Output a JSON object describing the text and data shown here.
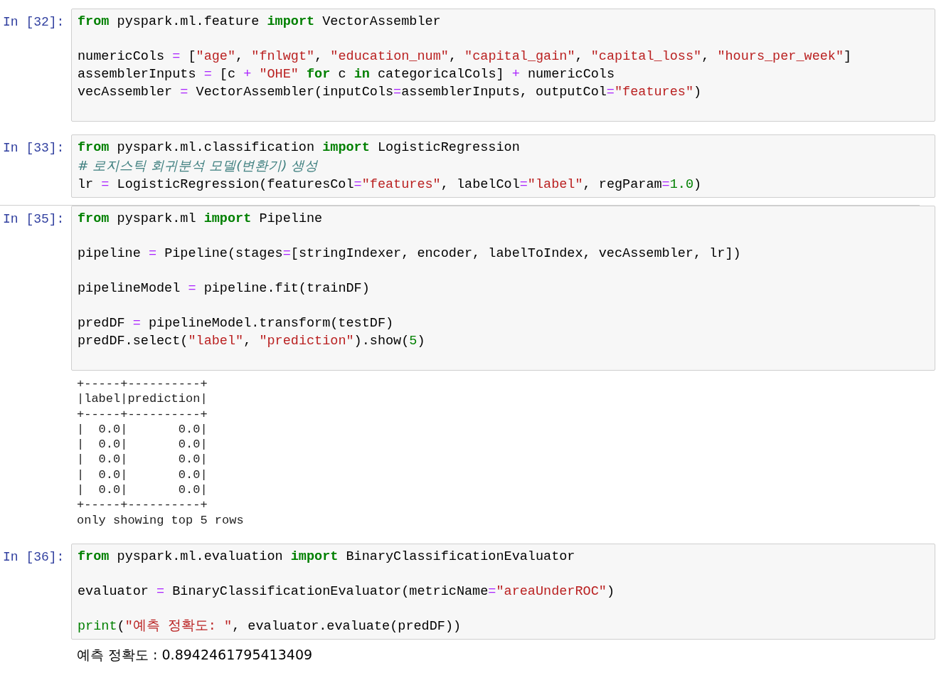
{
  "cells": [
    {
      "prompt": "In [32]:",
      "blocks": [
        [
          [
            {
              "kw": "from"
            },
            {
              "p": " pyspark.ml.feature "
            },
            {
              "kw": "import"
            },
            {
              "p": " VectorAssembler"
            }
          ]
        ],
        [
          [
            {
              "p": "numericCols "
            },
            {
              "op": "="
            },
            {
              "p": " ["
            },
            {
              "str": "\"age\""
            },
            {
              "p": ", "
            },
            {
              "str": "\"fnlwgt\""
            },
            {
              "p": ", "
            },
            {
              "str": "\"education_num\""
            },
            {
              "p": ", "
            },
            {
              "str": "\"capital_gain\""
            },
            {
              "p": ", "
            },
            {
              "str": "\"capital_loss\""
            },
            {
              "p": ", "
            },
            {
              "str": "\"hours_per_week\""
            },
            {
              "p": "]"
            }
          ],
          [
            {
              "p": "assemblerInputs "
            },
            {
              "op": "="
            },
            {
              "p": " [c "
            },
            {
              "op": "+"
            },
            {
              "str": " \"OHE\""
            },
            {
              "kw": " for"
            },
            {
              "p": " c "
            },
            {
              "kw": "in"
            },
            {
              "p": " categoricalCols] "
            },
            {
              "op": "+"
            },
            {
              "p": " numericCols"
            }
          ],
          [
            {
              "p": "vecAssembler "
            },
            {
              "op": "="
            },
            {
              "p": " VectorAssembler(inputCols"
            },
            {
              "op": "="
            },
            {
              "p": "assemblerInputs, outputCol"
            },
            {
              "op": "="
            },
            {
              "str": "\"features\""
            },
            {
              "p": ")"
            }
          ]
        ]
      ],
      "trailing_space": true
    },
    {
      "prompt": "In [33]:",
      "blocks": [
        [
          [
            {
              "kw": "from"
            },
            {
              "p": " pyspark.ml.classification "
            },
            {
              "kw": "import"
            },
            {
              "p": " LogisticRegression"
            }
          ],
          [
            {
              "com": "# 로지스틱 회귀분석 모델(변환기) 생성"
            }
          ],
          [
            {
              "p": "lr "
            },
            {
              "op": "="
            },
            {
              "p": " LogisticRegression(featuresCol"
            },
            {
              "op": "="
            },
            {
              "str": "\"features\""
            },
            {
              "p": ", labelCol"
            },
            {
              "op": "="
            },
            {
              "str": "\"label\""
            },
            {
              "p": ", regParam"
            },
            {
              "op": "="
            },
            {
              "num": "1.0"
            },
            {
              "p": ")"
            }
          ]
        ]
      ],
      "trailing_space": false
    },
    {
      "prompt": "In [35]:",
      "blocks": [
        [
          [
            {
              "kw": "from"
            },
            {
              "p": " pyspark.ml "
            },
            {
              "kw": "import"
            },
            {
              "p": " Pipeline"
            }
          ]
        ],
        [
          [
            {
              "p": "pipeline "
            },
            {
              "op": "="
            },
            {
              "p": " Pipeline(stages"
            },
            {
              "op": "="
            },
            {
              "p": "[stringIndexer, encoder, labelToIndex, vecAssembler, lr])"
            }
          ]
        ],
        [
          [
            {
              "p": "pipelineModel "
            },
            {
              "op": "="
            },
            {
              "p": " pipeline.fit(trainDF)"
            }
          ]
        ],
        [
          [
            {
              "p": "predDF "
            },
            {
              "op": "="
            },
            {
              "p": " pipelineModel.transform(testDF)"
            }
          ],
          [
            {
              "p": "predDF.select("
            },
            {
              "str": "\"label\""
            },
            {
              "p": ", "
            },
            {
              "str": "\"prediction\""
            },
            {
              "p": ").show("
            },
            {
              "num": "5"
            },
            {
              "p": ")"
            }
          ]
        ]
      ],
      "trailing_space": true,
      "output": {
        "kind": "mono",
        "lines": [
          "+-----+----------+",
          "|label|prediction|",
          "+-----+----------+",
          "|  0.0|       0.0|",
          "|  0.0|       0.0|",
          "|  0.0|       0.0|",
          "|  0.0|       0.0|",
          "|  0.0|       0.0|",
          "+-----+----------+",
          "only showing top 5 rows"
        ]
      }
    },
    {
      "prompt": "In [36]:",
      "blocks": [
        [
          [
            {
              "kw": "from"
            },
            {
              "p": " pyspark.ml.evaluation "
            },
            {
              "kw": "import"
            },
            {
              "p": " BinaryClassificationEvaluator"
            }
          ]
        ],
        [
          [
            {
              "p": "evaluator "
            },
            {
              "op": "="
            },
            {
              "p": " BinaryClassificationEvaluator(metricName"
            },
            {
              "op": "="
            },
            {
              "str": "\"areaUnderROC\""
            },
            {
              "p": ")"
            }
          ]
        ],
        [
          [
            {
              "bi": "print"
            },
            {
              "p": "("
            },
            {
              "str": "\"예측 정확도: \""
            },
            {
              "p": ", evaluator.evaluate(predDF))"
            }
          ]
        ]
      ],
      "trailing_space": false,
      "output": {
        "kind": "text",
        "lines": [
          "예측 정확도 : 0.8942461795413409"
        ]
      }
    }
  ]
}
